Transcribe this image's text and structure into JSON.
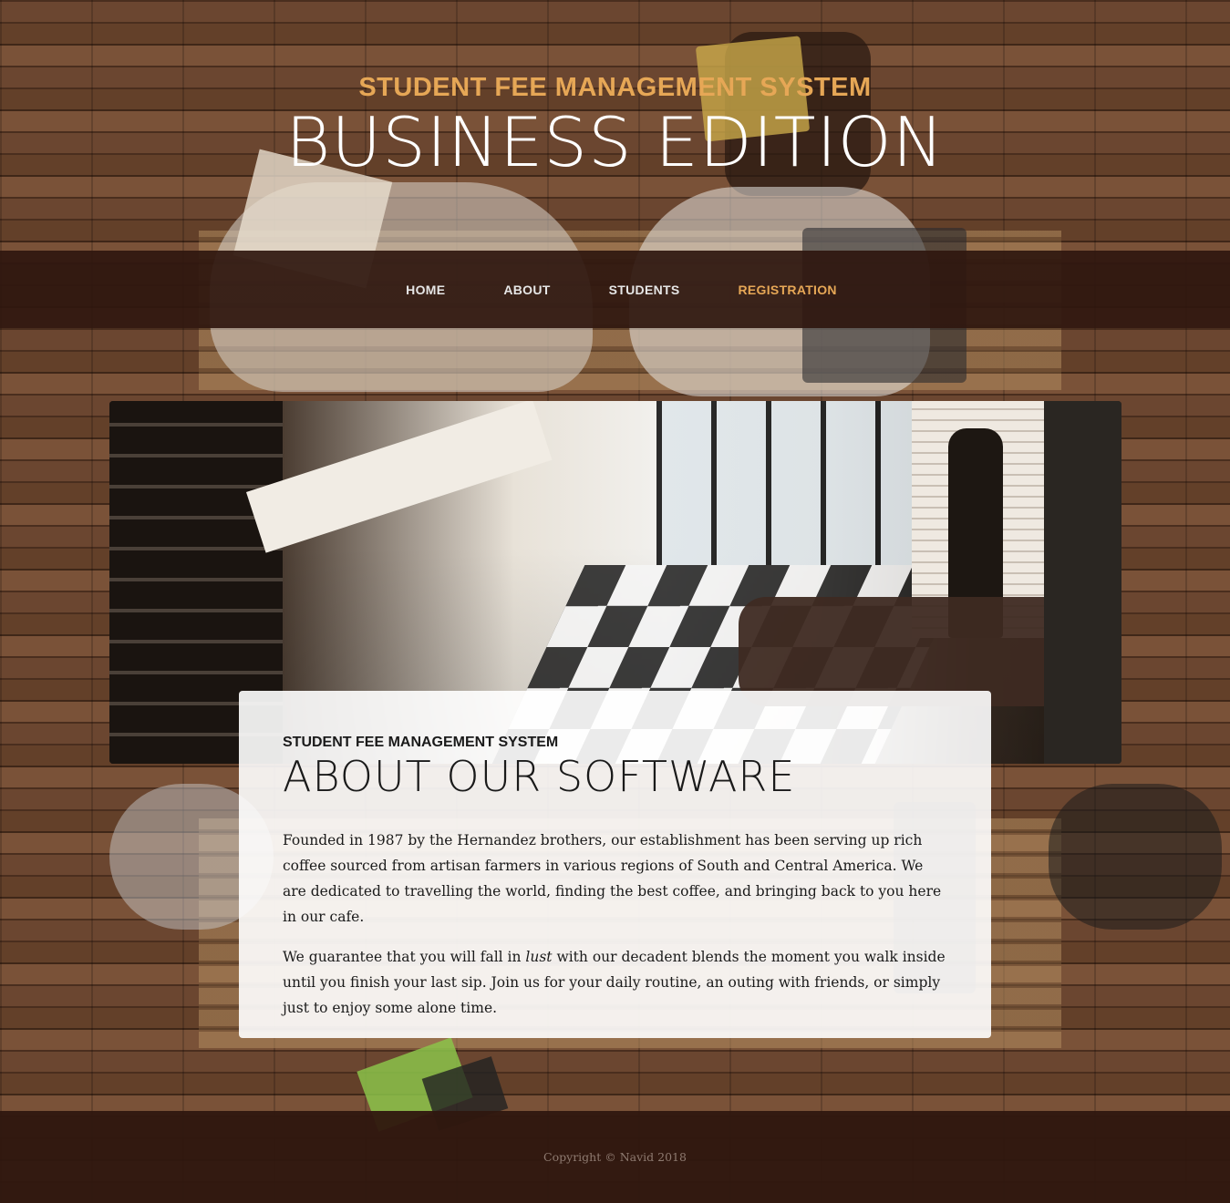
{
  "header": {
    "upper": "STUDENT FEE MANAGEMENT SYSTEM",
    "lower": "BUSINESS EDITION"
  },
  "nav": {
    "items": [
      {
        "label": "HOME",
        "active": false
      },
      {
        "label": "ABOUT",
        "active": false
      },
      {
        "label": "STUDENTS",
        "active": false
      },
      {
        "label": "REGISTRATION",
        "active": true
      }
    ]
  },
  "intro": {
    "upper": "STUDENT FEE MANAGEMENT SYSTEM",
    "lower": "ABOUT OUR SOFTWARE",
    "p1": "Founded in 1987 by the Hernandez brothers, our establishment has been serving up rich coffee sourced from artisan farmers in various regions of South and Central America. We are dedicated to travelling the world, finding the best coffee, and bringing back to you here in our cafe.",
    "p2_before": "We guarantee that you will fall in ",
    "p2_em": "lust",
    "p2_after": " with our decadent blends the moment you walk inside until you finish your last sip. Join us for your daily routine, an outing with friends, or simply just to enjoy some alone time."
  },
  "footer": {
    "copyright": "Copyright © Navid 2018"
  },
  "colors": {
    "accent": "#e6a756",
    "nav_bg": "#2f170f",
    "text_dark": "#1a1a1a"
  }
}
